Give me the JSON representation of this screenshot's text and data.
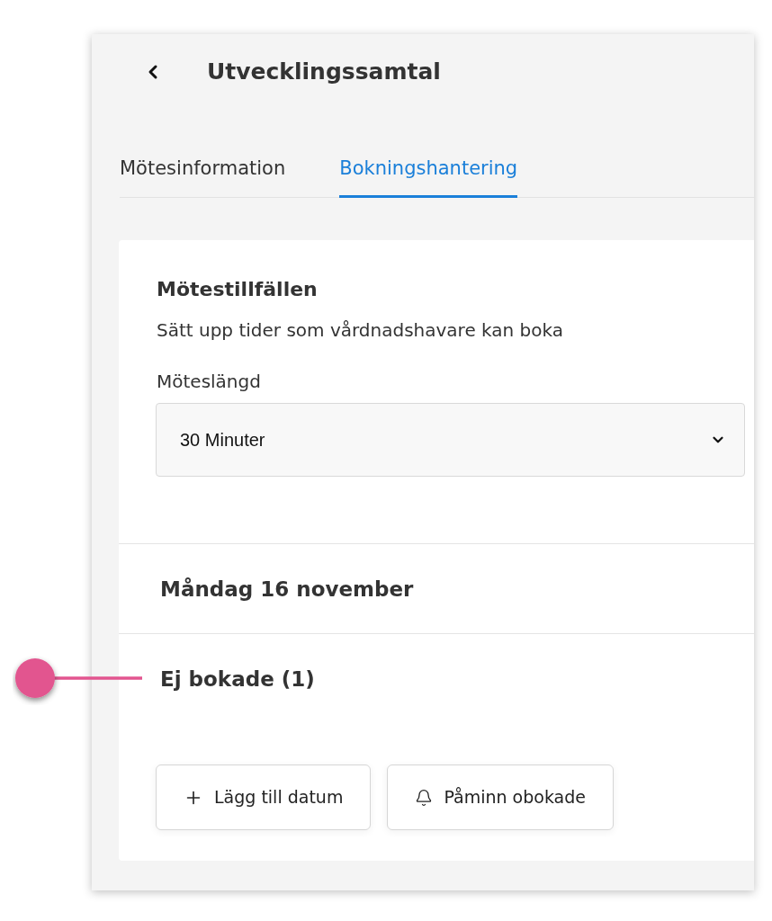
{
  "header": {
    "title": "Utvecklingssamtal"
  },
  "tabs": [
    {
      "label": "Mötesinformation",
      "selected": false
    },
    {
      "label": "Bokningshantering",
      "selected": true
    }
  ],
  "section": {
    "title": "Mötestillfällen",
    "description": "Sätt upp tider som vårdnadshavare kan boka",
    "field": {
      "label": "Möteslängd",
      "value": "30 Minuter"
    }
  },
  "day": {
    "title": "Måndag 16 november"
  },
  "group": {
    "title": "Ej bokade (1)"
  },
  "buttons": [
    {
      "kind": "add",
      "label": "Lägg till datum"
    },
    {
      "kind": "remind",
      "label": "Påminn obokade"
    }
  ]
}
